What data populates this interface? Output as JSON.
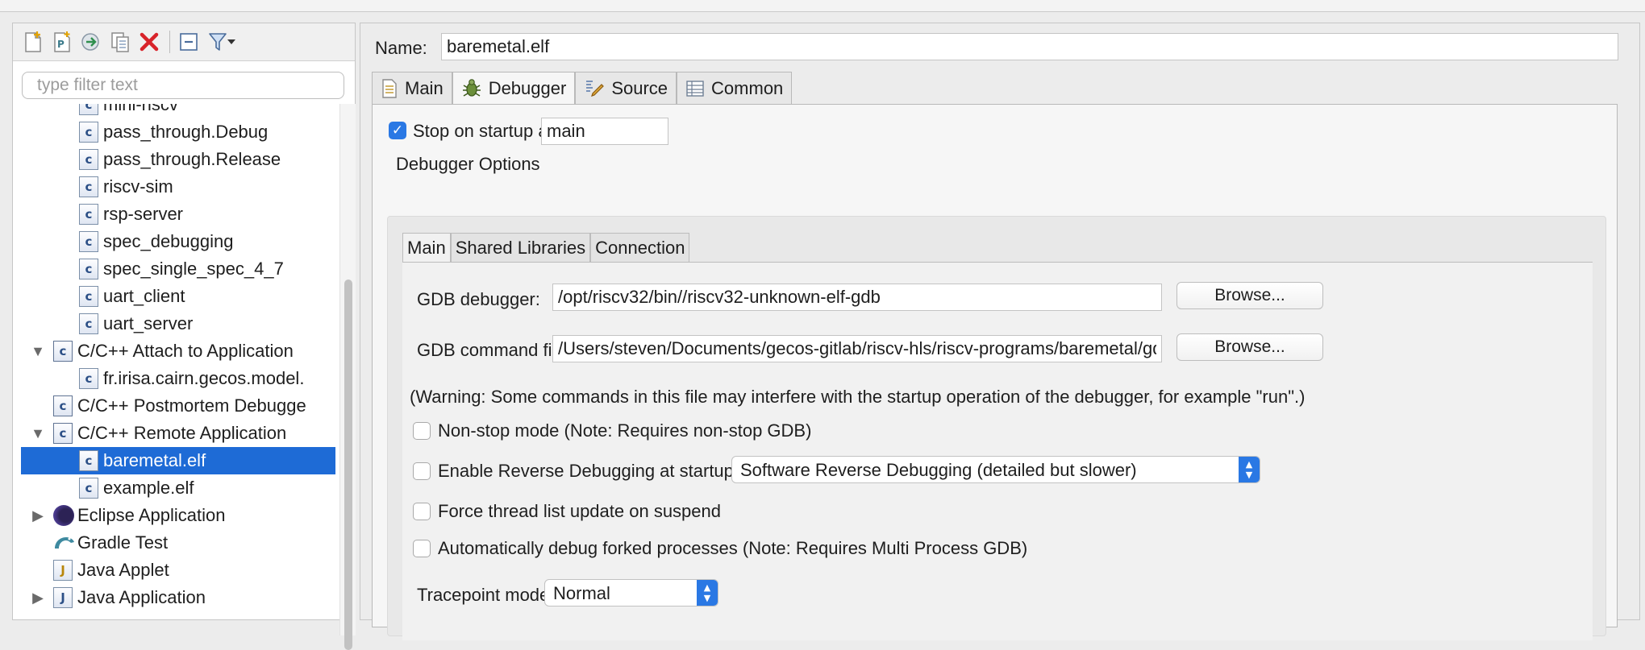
{
  "left": {
    "toolbar": {
      "icons": [
        "new-configuration-icon",
        "new-prototype-icon",
        "export-icon",
        "duplicate-icon",
        "delete-icon",
        "collapse-all-icon",
        "filter-icon",
        "view-menu-icon"
      ]
    },
    "filter_placeholder": "type filter text",
    "tree": [
      {
        "label": "mini-riscv",
        "indent": 2
      },
      {
        "label": "pass_through.Debug",
        "indent": 2
      },
      {
        "label": "pass_through.Release",
        "indent": 2
      },
      {
        "label": "riscv-sim",
        "indent": 2
      },
      {
        "label": "rsp-server",
        "indent": 2
      },
      {
        "label": "spec_debugging",
        "indent": 2
      },
      {
        "label": "spec_single_spec_4_7",
        "indent": 2
      },
      {
        "label": "uart_client",
        "indent": 2
      },
      {
        "label": "uart_server",
        "indent": 2
      },
      {
        "label": "C/C++ Attach to Application",
        "indent": 1
      },
      {
        "label": "fr.irisa.cairn.gecos.model.",
        "indent": 2
      },
      {
        "label": "C/C++ Postmortem Debugge",
        "indent": 1
      },
      {
        "label": "C/C++ Remote Application",
        "indent": 1
      },
      {
        "label": "baremetal.elf",
        "indent": 2
      },
      {
        "label": "example.elf",
        "indent": 2
      },
      {
        "label": "Eclipse Application",
        "indent": 1
      },
      {
        "label": "Gradle Test",
        "indent": 1
      },
      {
        "label": "Java Applet",
        "indent": 1
      },
      {
        "label": "Java Application",
        "indent": 1
      }
    ]
  },
  "right": {
    "name_label": "Name:",
    "name_value": "baremetal.elf",
    "tabs": [
      {
        "label": "Main",
        "icon": "document-icon"
      },
      {
        "label": "Debugger",
        "icon": "bug-icon"
      },
      {
        "label": "Source",
        "icon": "source-icon"
      },
      {
        "label": "Common",
        "icon": "common-icon"
      }
    ],
    "stop_on_startup": {
      "label": "Stop on startup at:",
      "value": "main",
      "checked": true
    },
    "debugger_options_title": "Debugger Options",
    "subtabs": [
      "Main",
      "Shared Libraries",
      "Connection"
    ],
    "gdb_debugger": {
      "label": "GDB debugger:",
      "value": "/opt/riscv32/bin//riscv32-unknown-elf-gdb",
      "browse": "Browse..."
    },
    "gdb_command_file": {
      "label": "GDB command file:",
      "value": "/Users/steven/Documents/gecos-gitlab/riscv-hls/riscv-programs/baremetal/gdbcommand",
      "browse": "Browse..."
    },
    "warning": "(Warning: Some commands in this file may interfere with the startup operation of the debugger, for example \"run\".)",
    "non_stop": "Non-stop mode (Note: Requires non-stop GDB)",
    "reverse_debugging": {
      "label": "Enable Reverse Debugging at startup using:",
      "option": "Software Reverse Debugging (detailed but slower)"
    },
    "force_thread": "Force thread list update on suspend",
    "auto_forked": "Automatically debug forked processes (Note: Requires Multi Process GDB)",
    "tracepoint": {
      "label": "Tracepoint mode:",
      "option": "Normal"
    }
  }
}
